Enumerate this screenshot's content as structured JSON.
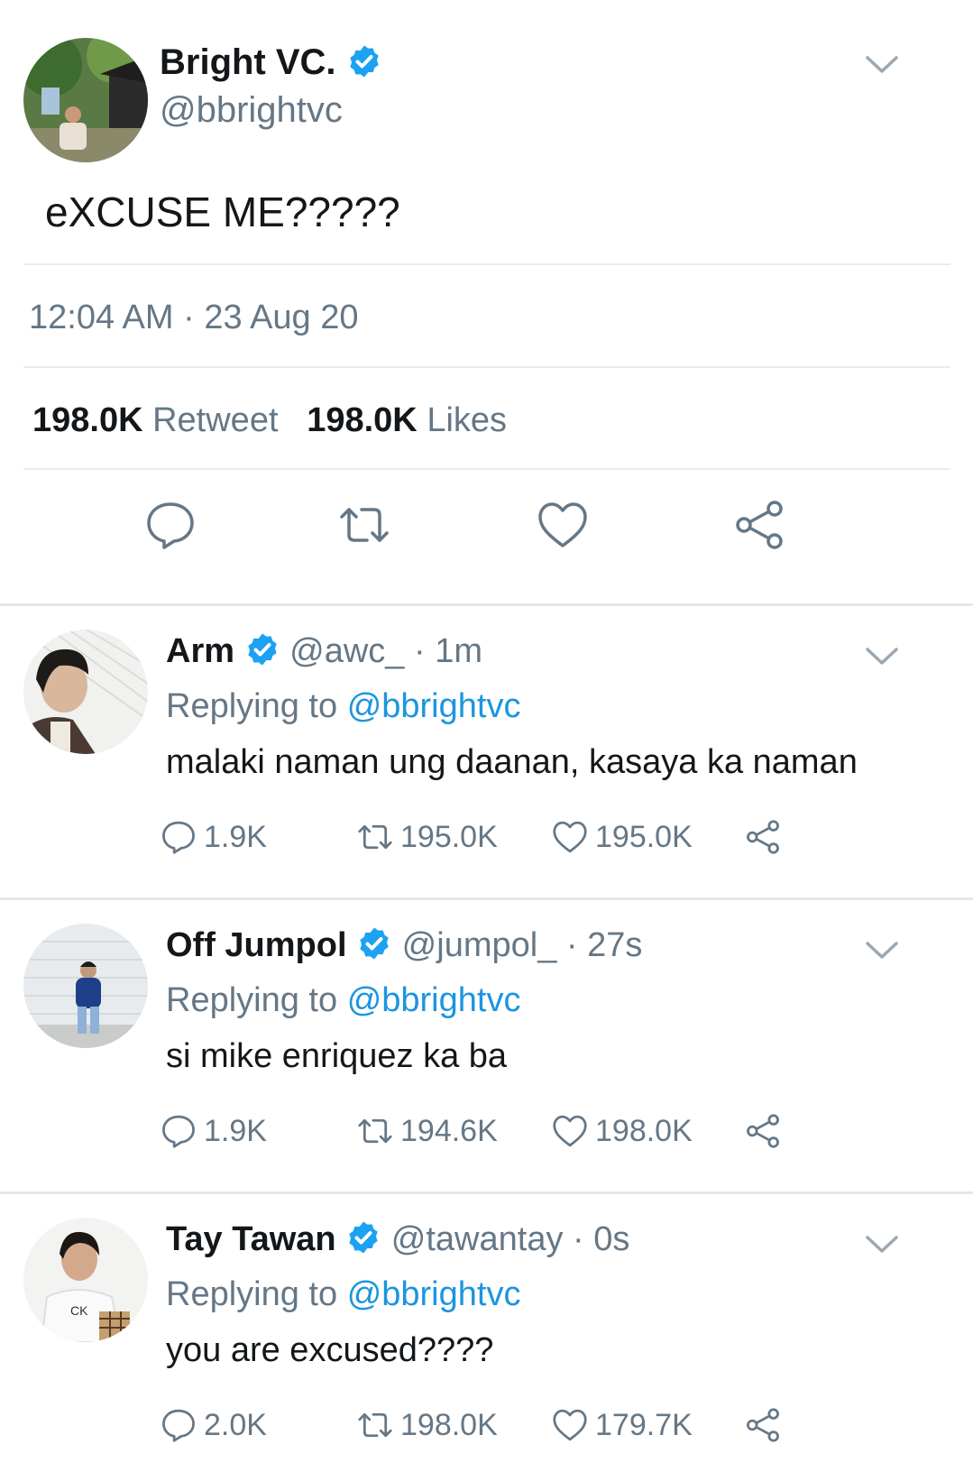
{
  "main_tweet": {
    "name": "Bright VC.",
    "handle": "@bbrightvc",
    "text": "eXCUSE ME?????",
    "time": "12:04 AM",
    "separator": "·",
    "date": "23 Aug 20",
    "retweets_count": "198.0K",
    "retweets_label": "Retweet",
    "likes_count": "198.0K",
    "likes_label": "Likes",
    "verified": true
  },
  "replies": [
    {
      "name": "Arm",
      "handle": "@awc_",
      "time": "· 1m",
      "replying_label": "Replying to",
      "replying_to": "@bbrightvc",
      "text": "malaki naman ung daanan, kasaya ka naman",
      "comments": "1.9K",
      "retweets": "195.0K",
      "likes": "195.0K"
    },
    {
      "name": "Off Jumpol",
      "handle": "@jumpol_",
      "time": "· 27s",
      "replying_label": "Replying to",
      "replying_to": "@bbrightvc",
      "text": "si mike enriquez ka ba",
      "comments": "1.9K",
      "retweets": "194.6K",
      "likes": "198.0K"
    },
    {
      "name": "Tay Tawan",
      "handle": "@tawantay",
      "time": "· 0s",
      "replying_label": "Replying to",
      "replying_to": "@bbrightvc",
      "text": "you are excused????",
      "comments": "2.0K",
      "retweets": "198.0K",
      "likes": "179.7K"
    }
  ],
  "icons": {
    "verified": "verified-badge-icon",
    "chevron": "chevron-down-icon",
    "reply": "reply-icon",
    "retweet": "retweet-icon",
    "like": "heart-icon",
    "share": "share-icon"
  },
  "colors": {
    "text": "#14171a",
    "secondary": "#657786",
    "link": "#1b95e0",
    "verified": "#1da1f2",
    "divider": "#e6ecf0"
  }
}
